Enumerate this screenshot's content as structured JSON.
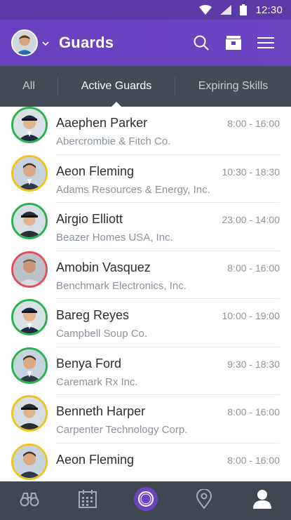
{
  "status_bar": {
    "time": "12:30"
  },
  "app_bar": {
    "title": "Guards"
  },
  "tabs": [
    {
      "label": "All"
    },
    {
      "label": "Active Guards"
    },
    {
      "label": "Expiring Skills"
    }
  ],
  "guards": [
    {
      "name": "Aaephen Parker",
      "company": "Abercrombie & Fitch Co.",
      "time": "8:00 - 16:00",
      "status_color": "#2ab24a"
    },
    {
      "name": "Aeon Fleming",
      "company": "Adams Resources & Energy, Inc.",
      "time": "10:30 - 18:30",
      "status_color": "#f2c21b"
    },
    {
      "name": "Airgio Elliott",
      "company": "Beazer Homes USA, Inc.",
      "time": "23:00 - 14:00",
      "status_color": "#2ab24a"
    },
    {
      "name": "Amobin Vasquez",
      "company": "Benchmark Electronics, Inc.",
      "time": "8:00 - 16:00",
      "status_color": "#e8495b"
    },
    {
      "name": "Bareg Reyes",
      "company": "Campbell Soup Co.",
      "time": "10:00 - 19:00",
      "status_color": "#2ab24a"
    },
    {
      "name": "Benya Ford",
      "company": "Caremark Rx Inc.",
      "time": "9:30 - 18:30",
      "status_color": "#2ab24a"
    },
    {
      "name": "Benneth Harper",
      "company": "Carpenter Technology Corp.",
      "time": "8:00 - 16:00",
      "status_color": "#f2c21b"
    },
    {
      "name": "Aeon Fleming",
      "company": "",
      "time": "8:00 - 16:00",
      "status_color": "#f2c21b"
    }
  ],
  "bottom_nav": [
    {
      "icon": "binoculars-icon"
    },
    {
      "icon": "calendar-icon"
    },
    {
      "icon": "ring-icon"
    },
    {
      "icon": "map-pin-icon"
    },
    {
      "icon": "user-icon"
    }
  ],
  "colors": {
    "app_bar": "#6741bf",
    "tabs_bg": "#434b55",
    "bottom_nav_bg": "#3f4750",
    "accent_purple": "#6a45c0"
  }
}
